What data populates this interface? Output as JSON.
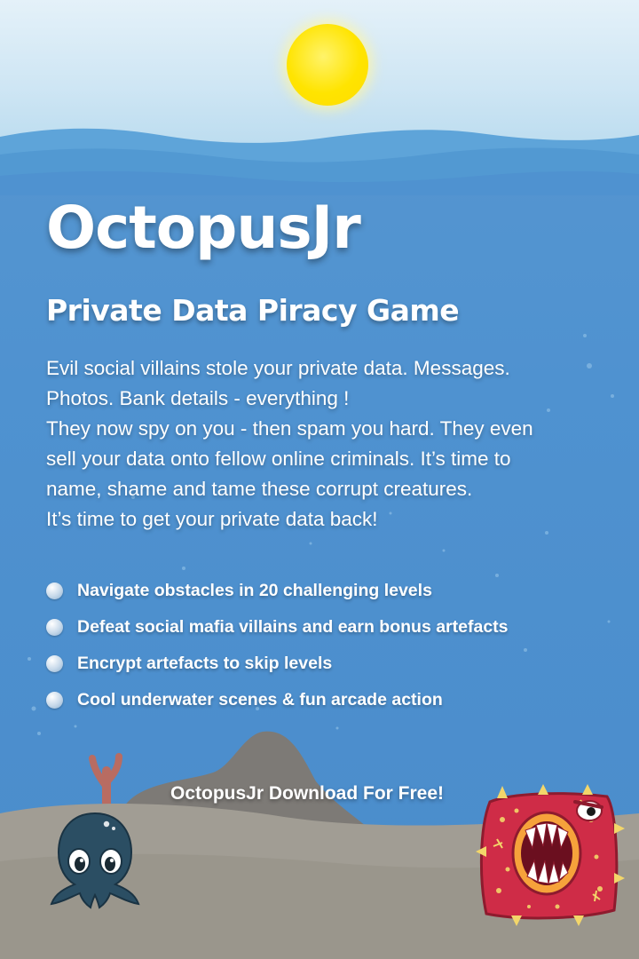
{
  "game": {
    "title": "OctopusJr",
    "subtitle": "Private Data Piracy Game",
    "description": [
      "Evil social villains stole your private data. Messages.",
      "Photos. Bank details - everything !",
      "They now spy on you - then spam you hard. They even",
      "sell your data onto fellow online criminals. It’s time to",
      "name, shame and tame these corrupt creatures.",
      "It’s time to get your private data back!"
    ],
    "features": [
      "Navigate obstacles in 20 challenging levels",
      "Defeat social mafia villains and earn bonus artefacts",
      "Encrypt artefacts to skip levels",
      "Cool underwater scenes & fun arcade action"
    ],
    "cta": "OctopusJr Download For Free!"
  },
  "colors": {
    "sky": "#d6eaf6",
    "sun": "#ffe400",
    "sea": "#4f92d0",
    "sand": "#a19d94",
    "rock": "#7d7a76",
    "coral": "#b86c62",
    "octopus": "#2b4e63",
    "monster": "#cf2c47"
  },
  "icons": {
    "bullet": "bubble-bullet-icon",
    "octopus": "octopus-character",
    "monster": "red-monster-character"
  }
}
